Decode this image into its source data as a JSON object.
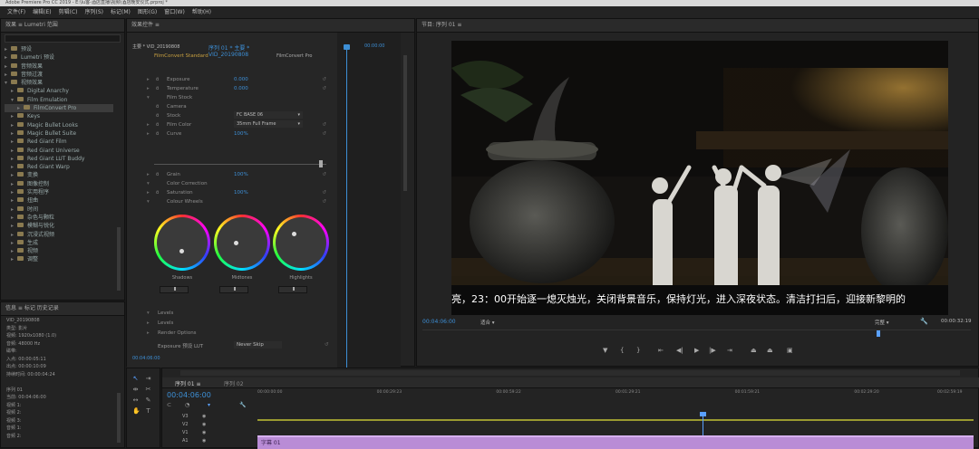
{
  "window": {
    "title": "Adobe Premiere Pro CC 2019 - E:\\lu客-酒店直播\\视频\\酒店晚安仪式.prproj *"
  },
  "menu": [
    "文件(F)",
    "编辑(E)",
    "剪辑(C)",
    "序列(S)",
    "标记(M)",
    "图形(G)",
    "窗口(W)",
    "帮助(H)"
  ],
  "project": {
    "header": "效果 ≡   Lumetri 范围",
    "items": [
      {
        "label": "预设",
        "indent": 0,
        "open": false
      },
      {
        "label": "Lumetri 预设",
        "indent": 0,
        "open": false
      },
      {
        "label": "音频效果",
        "indent": 0,
        "open": false
      },
      {
        "label": "音频过渡",
        "indent": 0,
        "open": false
      },
      {
        "label": "视频效果",
        "indent": 0,
        "open": true
      },
      {
        "label": "Digital Anarchy",
        "indent": 1,
        "open": false
      },
      {
        "label": "Film Emulation",
        "indent": 1,
        "open": true
      },
      {
        "label": "FilmConvert Pro",
        "indent": 2,
        "open": false,
        "selected": true
      },
      {
        "label": "Keys",
        "indent": 1,
        "open": false
      },
      {
        "label": "Magic Bullet Looks",
        "indent": 1,
        "open": false
      },
      {
        "label": "Magic Bullet Suite",
        "indent": 1,
        "open": false
      },
      {
        "label": "Red Giant Film",
        "indent": 1,
        "open": false
      },
      {
        "label": "Red Giant Universe",
        "indent": 1,
        "open": false
      },
      {
        "label": "Red Giant LUT Buddy",
        "indent": 1,
        "open": false
      },
      {
        "label": "Red Giant Warp",
        "indent": 1,
        "open": false
      },
      {
        "label": "变换",
        "indent": 1,
        "open": false
      },
      {
        "label": "图像控制",
        "indent": 1,
        "open": false
      },
      {
        "label": "实用程序",
        "indent": 1,
        "open": false
      },
      {
        "label": "扭曲",
        "indent": 1,
        "open": false
      },
      {
        "label": "时间",
        "indent": 1,
        "open": false
      },
      {
        "label": "杂色与颗粒",
        "indent": 1,
        "open": false
      },
      {
        "label": "模糊与锐化",
        "indent": 1,
        "open": false
      },
      {
        "label": "沉浸式视频",
        "indent": 1,
        "open": false
      },
      {
        "label": "生成",
        "indent": 1,
        "open": false
      },
      {
        "label": "视频",
        "indent": 1,
        "open": false
      },
      {
        "label": "调整",
        "indent": 1,
        "open": false
      }
    ]
  },
  "info": {
    "tabs": "信息 ≡   标记   历史记录",
    "lines": [
      "VID_20190808",
      "类型: 影片",
      "视频: 1920x1080 (1.0)",
      "音频: 48000 Hz",
      "磁带:",
      "入点: 00:00:05:11",
      "出点: 00:00:10:09",
      "持续时间: 00:00:04:24",
      "",
      "序列 01",
      "当前: 00:04:06:00",
      "视频 1:",
      "视频 2:",
      "视频 3:",
      "音频 1:",
      "音频 2:"
    ]
  },
  "effects": {
    "tab": "效果控件 ≡",
    "source": "主要 * VID_20190808",
    "seq": "序列 01 * 主要 * VID_20190808",
    "time": "00:00:00",
    "plugin": "FilmConvert Standard",
    "plugin_right": "FilmConvert Pro",
    "rows": [
      {
        "tri": "▸",
        "ico": "ö",
        "label": "Exposure",
        "val": "0.000",
        "reset": "↺"
      },
      {
        "tri": "▸",
        "ico": "ö",
        "label": "Temperature",
        "val": "0.000",
        "reset": "↺"
      },
      {
        "tri": "▾",
        "ico": "",
        "label": "Film Stock",
        "val": "",
        "reset": ""
      },
      {
        "tri": "",
        "ico": "ö",
        "label": "Camera",
        "val": "",
        "reset": ""
      },
      {
        "tri": "",
        "ico": "ö",
        "label": "Stock",
        "val": "",
        "reset": ""
      },
      {
        "tri": "▸",
        "ico": "ö",
        "label": "Film Color",
        "val": "100%",
        "reset": "↺"
      },
      {
        "tri": "▸",
        "ico": "ö",
        "label": "Curve",
        "val": "100%",
        "reset": "↺"
      }
    ],
    "camera_value": "FC BASE 06",
    "stock_value": "35mm Full Frame",
    "rows2": [
      {
        "tri": "▸",
        "ico": "ö",
        "label": "Grain",
        "val": "100%",
        "reset": "↺"
      },
      {
        "tri": "▾",
        "ico": "",
        "label": "Color Correction",
        "val": "",
        "reset": ""
      },
      {
        "tri": "▸",
        "ico": "ö",
        "label": "Saturation",
        "val": "100%",
        "reset": "↺"
      },
      {
        "tri": "▾",
        "ico": "",
        "label": "Colour Wheels",
        "val": "",
        "reset": "↺"
      }
    ],
    "wheels": [
      "Shadows",
      "Midtones",
      "Highlights"
    ],
    "bottom_rows": [
      "Levels",
      "Levels",
      "Render Options"
    ],
    "bottom_ticks": [
      "▾",
      "▸",
      "▸"
    ],
    "export_label": "Exposure 预设 LUT",
    "export_value": "Never Skip",
    "footer_time": "00:04:06:00"
  },
  "program": {
    "tab": "节目: 序列 01 ≡",
    "subtitle": "亮，23：00开始逐一熄灭烛光，关闭背景音乐，保持灯光，进入深夜状态。清洁打扫后，迎接新黎明的",
    "timecode": "00:04:06:00",
    "fit": "适合",
    "quality": "完整",
    "duration": "00:00:32:19"
  },
  "timeline": {
    "tab": "序列 01 ≡",
    "tab2": "序列 02",
    "timecode": "00:04:06:00",
    "ruler": [
      "00:00:00:00",
      "00:00:29:23",
      "00:00:59:22",
      "00:01:29:21",
      "00:01:59:21",
      "00:02:29:20",
      "00:02:59:19"
    ],
    "tracks": [
      "V3",
      "V2",
      "V1",
      "A1"
    ],
    "clip": "字幕 01"
  },
  "colors": {
    "accent": "#3d8fd6",
    "clip": "#b98cd6",
    "playhead": "#5aa0ff",
    "selected": "#3c3c3c"
  }
}
